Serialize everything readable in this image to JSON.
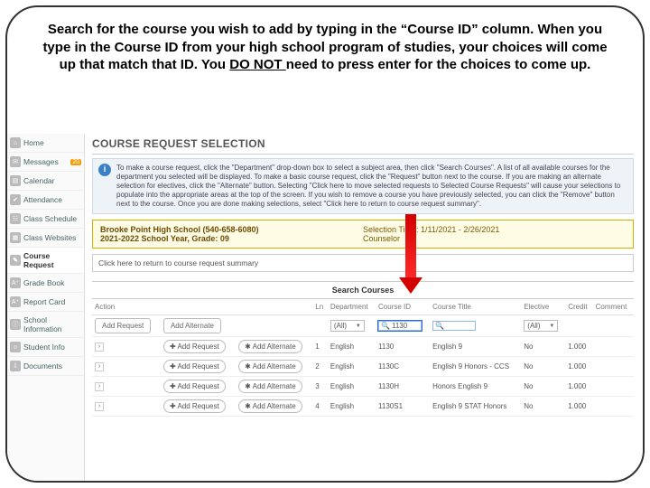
{
  "instruction": {
    "line1": "Search for the course you wish to add by typing in the “Course ID” column. When you type in the Course ID from your high school program of studies, your choices will come up that match that ID.  You ",
    "do_not": "DO NOT ",
    "line2": "need to press enter for the choices to come up."
  },
  "sidebar": {
    "items": [
      {
        "label": "Home",
        "icon": "⌂"
      },
      {
        "label": "Messages",
        "icon": "✉",
        "badge": "20"
      },
      {
        "label": "Calendar",
        "icon": "▤"
      },
      {
        "label": "Attendance",
        "icon": "✔"
      },
      {
        "label": "Class Schedule",
        "icon": "☷"
      },
      {
        "label": "Class Websites",
        "icon": "▦"
      },
      {
        "label": "Course Request",
        "icon": "✎"
      },
      {
        "label": "Grade Book",
        "icon": "A⁺"
      },
      {
        "label": "Report Card",
        "icon": "A⁺"
      },
      {
        "label": "School Information",
        "icon": "ⓘ"
      },
      {
        "label": "Student Info",
        "icon": "☺"
      },
      {
        "label": "Documents",
        "icon": "⇩"
      }
    ],
    "active_index": 6
  },
  "page": {
    "title": "COURSE REQUEST SELECTION",
    "info_text": "To make a course request, click the \"Department\" drop-down box to select a subject area, then click \"Search Courses\". A list of all available courses for the department you selected will be displayed. To make a basic course request, click the \"Request\" button next to the course. If you are making an alternate selection for electives, click the \"Alternate\" button. Selecting \"Click here to move selected requests to Selected Course Requests\" will cause your selections to populate into the appropriate areas at the top of the screen. If you wish to remove a course you have previously selected, you can click the \"Remove\" button next to the course. Once you are done making selections, select \"Click here to return to course request summary\"."
  },
  "yellow": {
    "school": "Brooke Point High School (540-658-6080)",
    "year": "2021-2022 School Year, Grade: 09",
    "selection_time": "Selection Time: 1/11/2021 - 2/26/2021",
    "counselor_label": "Counselor"
  },
  "links": {
    "return_summary": "Click here to return to course request summary"
  },
  "search_header": "Search Courses",
  "grid": {
    "headers": [
      "Action",
      "",
      "Ln",
      "Department",
      "Course ID",
      "Course Title",
      "Elective",
      "Credit",
      "Comment"
    ],
    "filter_row": {
      "add_request": "Add Request",
      "add_alternate": "Add Alternate",
      "department_value": "(All)",
      "course_id_value": "1130",
      "elective_value": "(All)"
    },
    "rows": [
      {
        "ln": "1",
        "dept": "English",
        "id": "1130",
        "title": "English 9",
        "elective": "No",
        "credit": "1.000"
      },
      {
        "ln": "2",
        "dept": "English",
        "id": "1130C",
        "title": "English 9 Honors - CCS",
        "elective": "No",
        "credit": "1.000"
      },
      {
        "ln": "3",
        "dept": "English",
        "id": "1130H",
        "title": "Honors English 9",
        "elective": "No",
        "credit": "1.000"
      },
      {
        "ln": "4",
        "dept": "English",
        "id": "1130S1",
        "title": "English 9 STAT Honors",
        "elective": "No",
        "credit": "1.000"
      }
    ],
    "row_buttons": {
      "add_request": "Add Request",
      "add_alternate": "Add Alternate"
    }
  }
}
